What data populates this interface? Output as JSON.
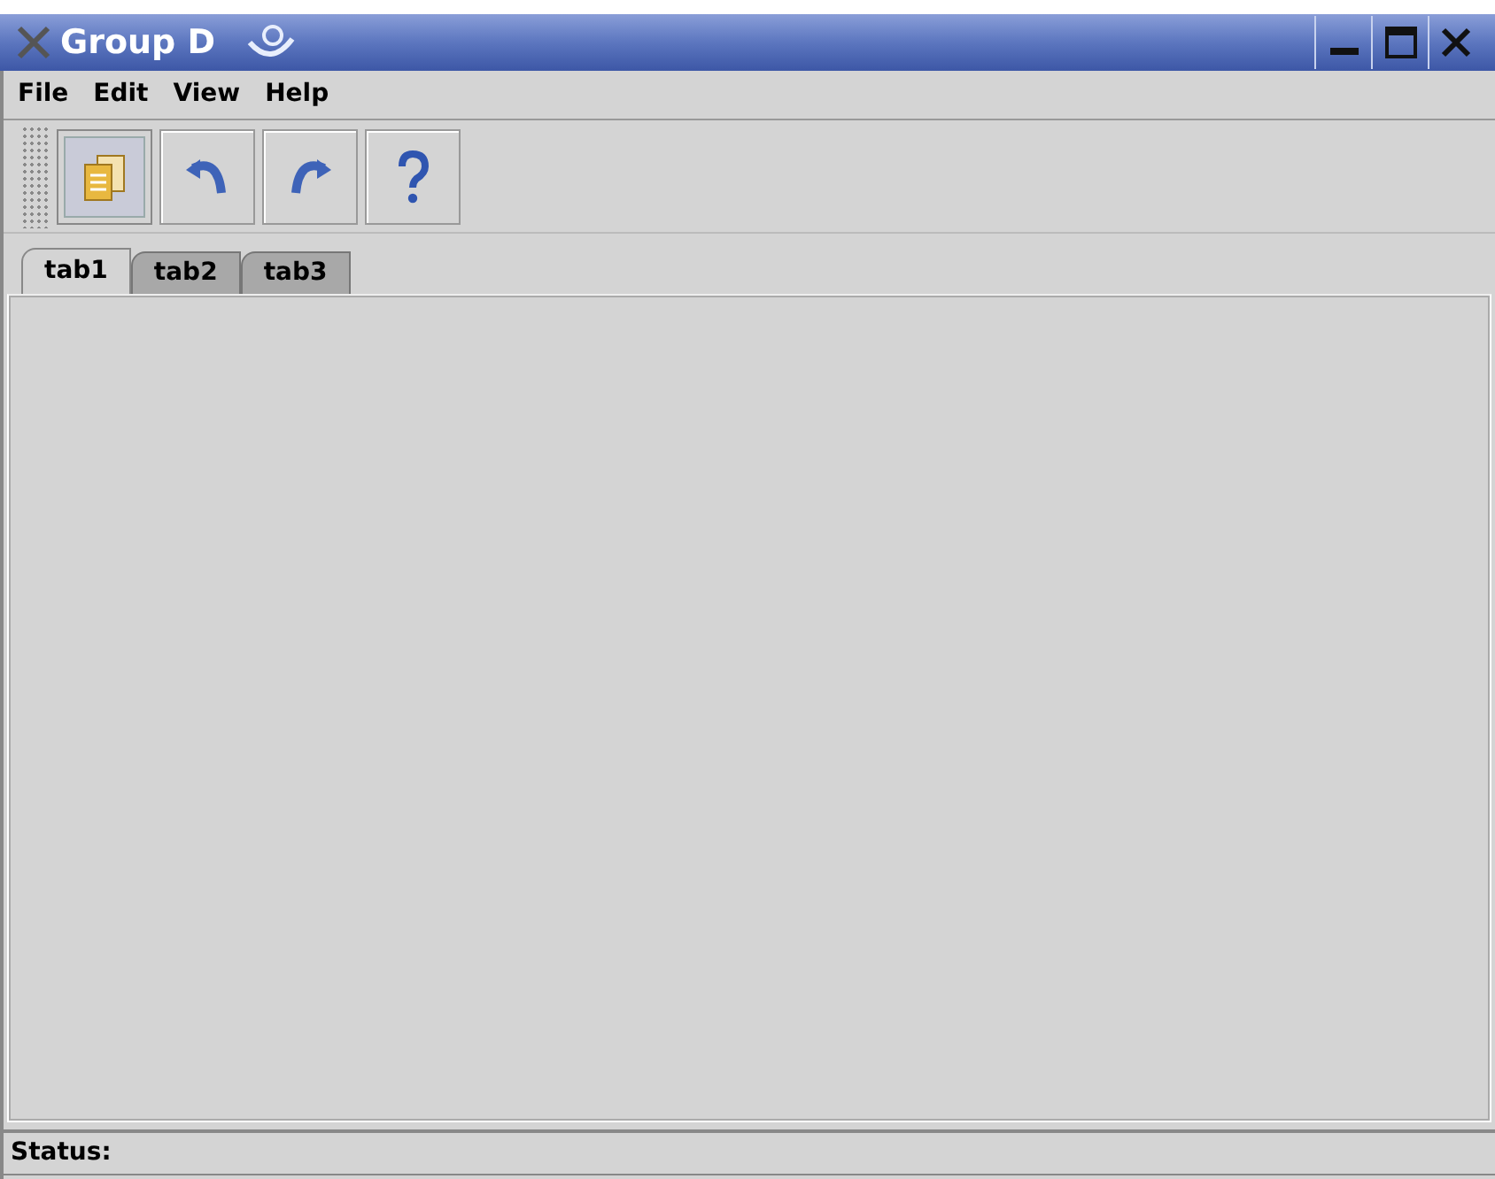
{
  "window": {
    "title": "Group D"
  },
  "menu": [
    "File",
    "Edit",
    "View",
    "Help"
  ],
  "toolbar": [
    {
      "kind": "copy",
      "selected": true
    },
    {
      "kind": "undo",
      "selected": false
    },
    {
      "kind": "redo",
      "selected": false
    },
    {
      "kind": "help",
      "selected": false
    }
  ],
  "tabs": [
    {
      "label": "tab1",
      "selected": true
    },
    {
      "label": "tab2",
      "selected": false
    },
    {
      "label": "tab3",
      "selected": false
    }
  ],
  "status_bar": "Status:"
}
